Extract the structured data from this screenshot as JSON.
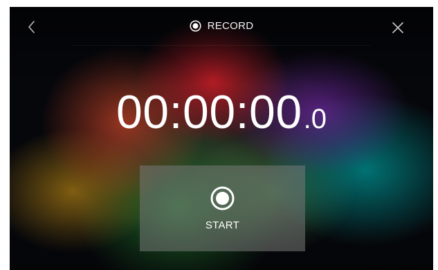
{
  "header": {
    "title": "RECORD",
    "title_icon": "record-icon",
    "back_icon": "chevron-left-icon",
    "close_icon": "close-icon"
  },
  "timer": {
    "main": "00:00:00",
    "tenths": ".0"
  },
  "start_button": {
    "label": "START",
    "icon": "record-icon"
  },
  "colors": {
    "text": "#ffffff",
    "button_background": "#787878"
  }
}
